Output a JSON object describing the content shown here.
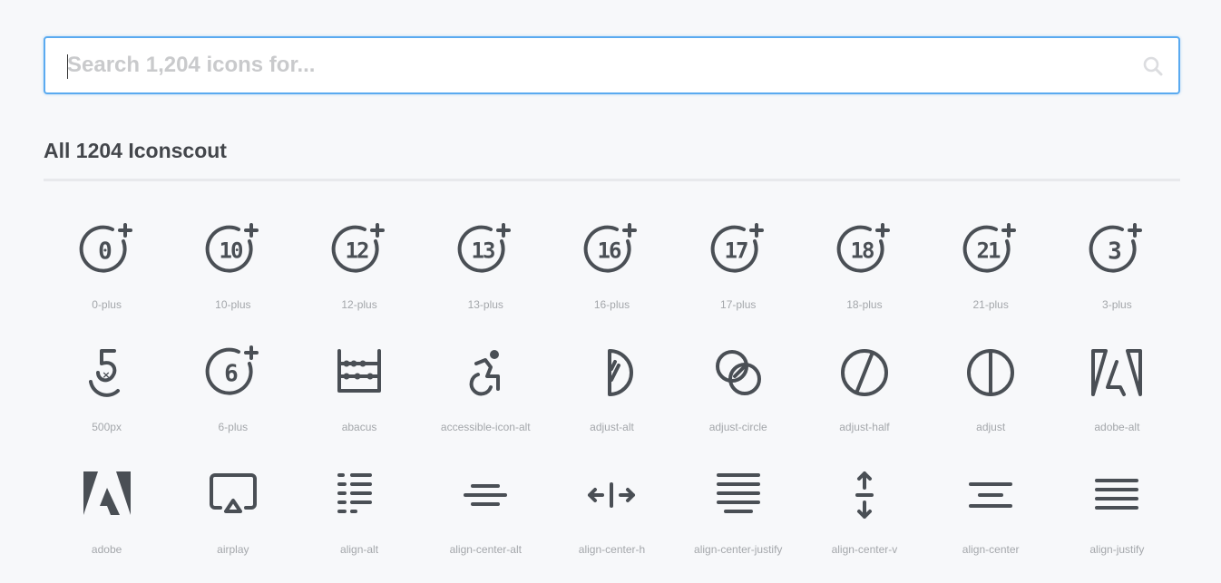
{
  "search": {
    "placeholder": "Search 1,204 icons for...",
    "value": "",
    "icon": "search-icon"
  },
  "heading": "All 1204 Iconscout",
  "colors": {
    "icon": "#4a4f55",
    "accent": "#5aaaf0",
    "label": "#a4a7ab"
  },
  "icons": [
    {
      "label": "0-plus",
      "num": "0"
    },
    {
      "label": "10-plus",
      "num": "10"
    },
    {
      "label": "12-plus",
      "num": "12"
    },
    {
      "label": "13-plus",
      "num": "13"
    },
    {
      "label": "16-plus",
      "num": "16"
    },
    {
      "label": "17-plus",
      "num": "17"
    },
    {
      "label": "18-plus",
      "num": "18"
    },
    {
      "label": "21-plus",
      "num": "21"
    },
    {
      "label": "3-plus",
      "num": "3"
    },
    {
      "label": "500px"
    },
    {
      "label": "6-plus",
      "num": "6"
    },
    {
      "label": "abacus"
    },
    {
      "label": "accessible-icon-alt"
    },
    {
      "label": "adjust-alt"
    },
    {
      "label": "adjust-circle"
    },
    {
      "label": "adjust-half"
    },
    {
      "label": "adjust"
    },
    {
      "label": "adobe-alt"
    },
    {
      "label": "adobe"
    },
    {
      "label": "airplay"
    },
    {
      "label": "align-alt"
    },
    {
      "label": "align-center-alt"
    },
    {
      "label": "align-center-h"
    },
    {
      "label": "align-center-justify"
    },
    {
      "label": "align-center-v"
    },
    {
      "label": "align-center"
    },
    {
      "label": "align-justify"
    }
  ]
}
